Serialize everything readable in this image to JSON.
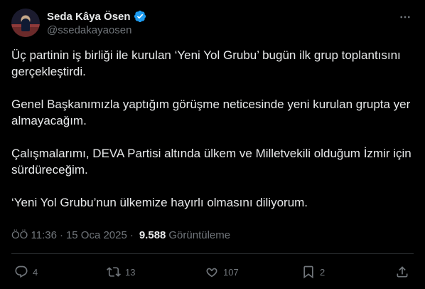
{
  "author": {
    "name": "Seda Kâya Ösen",
    "handle": "@ssedakayaosen",
    "verified_color": "#1d9bf0"
  },
  "tweet": {
    "paragraphs": [
      "Üç partinin iş birliği ile kurulan ‘Yeni Yol Grubu’ bugün ilk grup toplantısını gerçekleştirdi.",
      "Genel Başkanımızla yaptığım görüşme neticesinde yeni kurulan grupta yer almayacağım.",
      "Çalışmalarımı, DEVA Partisi altında ülkem ve Milletvekili olduğum İzmir için sürdüreceğim.",
      "‘Yeni Yol Grubu’nun ülkemize hayırlı olmasını diliyorum."
    ]
  },
  "meta": {
    "time": "ÖÖ 11:36",
    "separator": "·",
    "date": "15 Oca 2025",
    "views": "9.588",
    "views_label": "Görüntüleme"
  },
  "actions": {
    "replies": "4",
    "reposts": "13",
    "likes": "107",
    "bookmarks": "2"
  },
  "colors": {
    "background": "#000000",
    "text": "#e7e9ea",
    "muted": "#71767b",
    "divider": "#2f3336"
  }
}
